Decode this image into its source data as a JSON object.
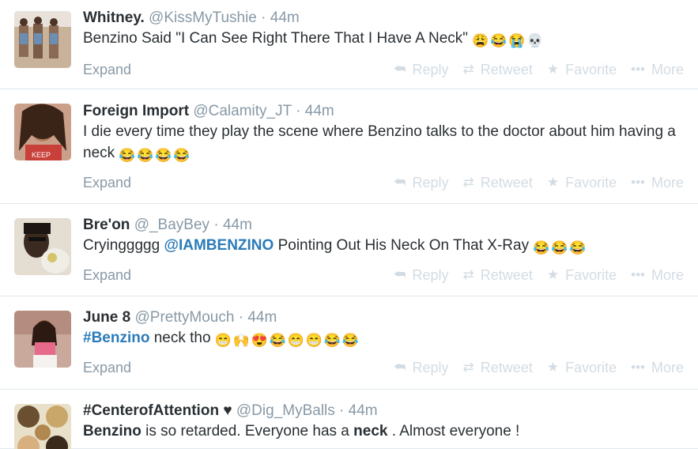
{
  "actions": {
    "reply": "Reply",
    "retweet": "Retweet",
    "favorite": "Favorite",
    "more": "More",
    "expand": "Expand"
  },
  "tweets": [
    {
      "fullname": "Whitney.",
      "username": "@KissMyTushie",
      "separator": "·",
      "time": "44m",
      "text_plain": "Benzino Said \"I Can See Right There That I Have A Neck\"",
      "emojis": [
        "😩",
        "😂",
        "😭",
        "💀"
      ]
    },
    {
      "fullname": "Foreign Import",
      "username": "@Calamity_JT",
      "separator": "·",
      "time": "44m",
      "text_plain": "I die every time they play the scene where Benzino talks to the doctor about him having a neck",
      "emojis": [
        "😂",
        "😂",
        "😂",
        "😂"
      ]
    },
    {
      "fullname": "Bre'on",
      "username": "@_BayBey",
      "separator": "·",
      "time": "44m",
      "text_before": "Cryinggggg",
      "mention": "@IAMBENZINO",
      "text_after": "Pointing Out His Neck On That X-Ray",
      "emojis": [
        "😂",
        "😂",
        "😂"
      ]
    },
    {
      "fullname": "June 8",
      "username": "@PrettyMouch",
      "separator": "·",
      "time": "44m",
      "hashtag": "#Benzino",
      "text_after": "neck tho",
      "emojis": [
        "😁",
        "🙌",
        "😍",
        "😂",
        "😁",
        "😁",
        "😂",
        "😂"
      ]
    },
    {
      "fullname": "#CenterofAttention ♥",
      "username": "@Dig_MyBalls",
      "separator": "·",
      "time": "44m",
      "bold1": "Benzino",
      "text_mid1": "is so retarded.  Everyone has a",
      "bold2": "neck",
      "text_mid2": ". Almost everyone !"
    }
  ],
  "colors": {
    "link": "#2b7bb9",
    "muted": "#8899a6",
    "action": "#d3dce3",
    "divider": "#e1e8ed"
  }
}
